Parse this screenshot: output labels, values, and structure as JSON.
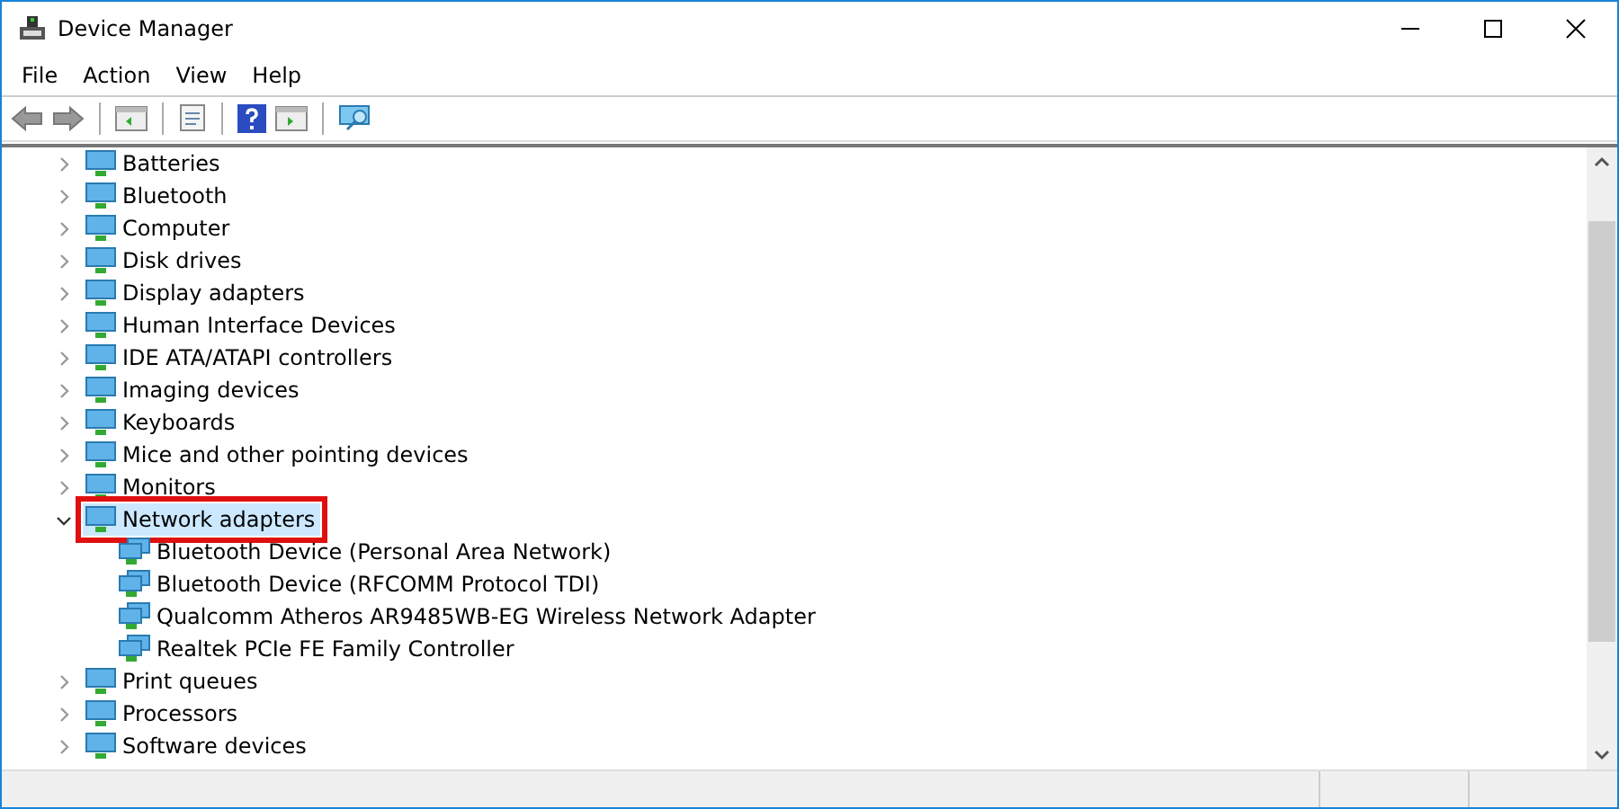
{
  "window": {
    "title": "Device Manager"
  },
  "menu": [
    "File",
    "Action",
    "View",
    "Help"
  ],
  "tree": [
    {
      "label": "Batteries",
      "expanded": false,
      "selected": false,
      "highlighted": false
    },
    {
      "label": "Bluetooth",
      "expanded": false,
      "selected": false,
      "highlighted": false
    },
    {
      "label": "Computer",
      "expanded": false,
      "selected": false,
      "highlighted": false
    },
    {
      "label": "Disk drives",
      "expanded": false,
      "selected": false,
      "highlighted": false
    },
    {
      "label": "Display adapters",
      "expanded": false,
      "selected": false,
      "highlighted": false
    },
    {
      "label": "Human Interface Devices",
      "expanded": false,
      "selected": false,
      "highlighted": false
    },
    {
      "label": "IDE ATA/ATAPI controllers",
      "expanded": false,
      "selected": false,
      "highlighted": false
    },
    {
      "label": "Imaging devices",
      "expanded": false,
      "selected": false,
      "highlighted": false
    },
    {
      "label": "Keyboards",
      "expanded": false,
      "selected": false,
      "highlighted": false
    },
    {
      "label": "Mice and other pointing devices",
      "expanded": false,
      "selected": false,
      "highlighted": false
    },
    {
      "label": "Monitors",
      "expanded": false,
      "selected": false,
      "highlighted": false
    },
    {
      "label": "Network adapters",
      "expanded": true,
      "selected": true,
      "highlighted": true,
      "children": [
        {
          "label": "Bluetooth Device (Personal Area Network)",
          "selected": false
        },
        {
          "label": "Bluetooth Device (RFCOMM Protocol TDI)",
          "selected": false
        },
        {
          "label": "Qualcomm Atheros AR9485WB-EG Wireless Network Adapter",
          "selected": false
        },
        {
          "label": "Realtek PCIe FE Family Controller",
          "selected": false
        }
      ]
    },
    {
      "label": "Print queues",
      "expanded": false,
      "selected": false,
      "highlighted": false
    },
    {
      "label": "Processors",
      "expanded": false,
      "selected": false,
      "highlighted": false
    },
    {
      "label": "Software devices",
      "expanded": false,
      "selected": false,
      "highlighted": false
    }
  ]
}
